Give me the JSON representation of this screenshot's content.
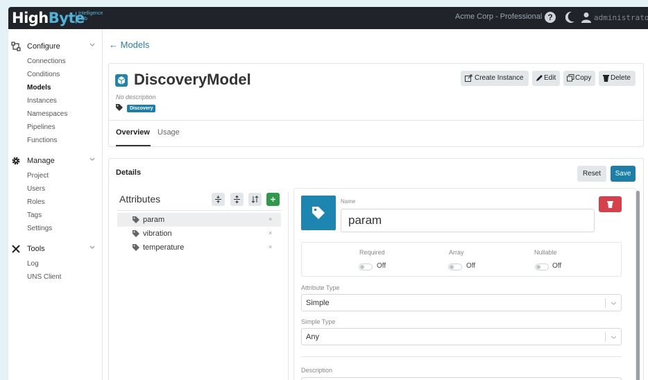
{
  "topbar": {
    "logo_main": "High",
    "logo_accent": "Byte",
    "logo_sub_1": "Intelligence",
    "logo_sub_2": "Hub",
    "org": "Acme Corp - Professional",
    "help_glyph": "?",
    "user": "administrator"
  },
  "sidebar": {
    "sections": [
      {
        "label": "Configure",
        "icon": "network-icon",
        "items": [
          "Connections",
          "Conditions",
          "Models",
          "Instances",
          "Namespaces",
          "Pipelines",
          "Functions"
        ]
      },
      {
        "label": "Manage",
        "icon": "gear-icon",
        "items": [
          "Project",
          "Users",
          "Roles",
          "Tags",
          "Settings"
        ]
      },
      {
        "label": "Tools",
        "icon": "tools-icon",
        "items": [
          "Log",
          "UNS Client"
        ]
      }
    ],
    "active_item": "Models"
  },
  "nav": {
    "back_label": "← Models"
  },
  "model": {
    "title": "DiscoveryModel",
    "description": "No description",
    "tag": "Discovery",
    "buttons": {
      "create_instance": "Create Instance",
      "edit": "Edit",
      "copy": "Copy",
      "delete": "Delete"
    },
    "tabs": [
      "Overview",
      "Usage"
    ],
    "active_tab": "Overview"
  },
  "details": {
    "title": "Details",
    "reset_label": "Reset",
    "save_label": "Save",
    "attributes_title": "Attributes",
    "attributes": [
      {
        "name": "param",
        "selected": true
      },
      {
        "name": "vibration",
        "selected": false
      },
      {
        "name": "temperature",
        "selected": false
      }
    ],
    "remove_glyph": "×",
    "add_glyph": "+"
  },
  "editor": {
    "name_label": "Name",
    "name_value": "param",
    "flags": [
      {
        "label": "Required",
        "state": "Off"
      },
      {
        "label": "Array",
        "state": "Off"
      },
      {
        "label": "Nullable",
        "state": "Off"
      }
    ],
    "attribute_type_label": "Attribute Type",
    "attribute_type_value": "Simple",
    "simple_type_label": "Simple Type",
    "simple_type_value": "Any",
    "description_label": "Description"
  },
  "colors": {
    "primary": "#1c7fa8",
    "danger": "#d6404a",
    "success": "#2e9a4a",
    "topbar": "#20232a"
  }
}
